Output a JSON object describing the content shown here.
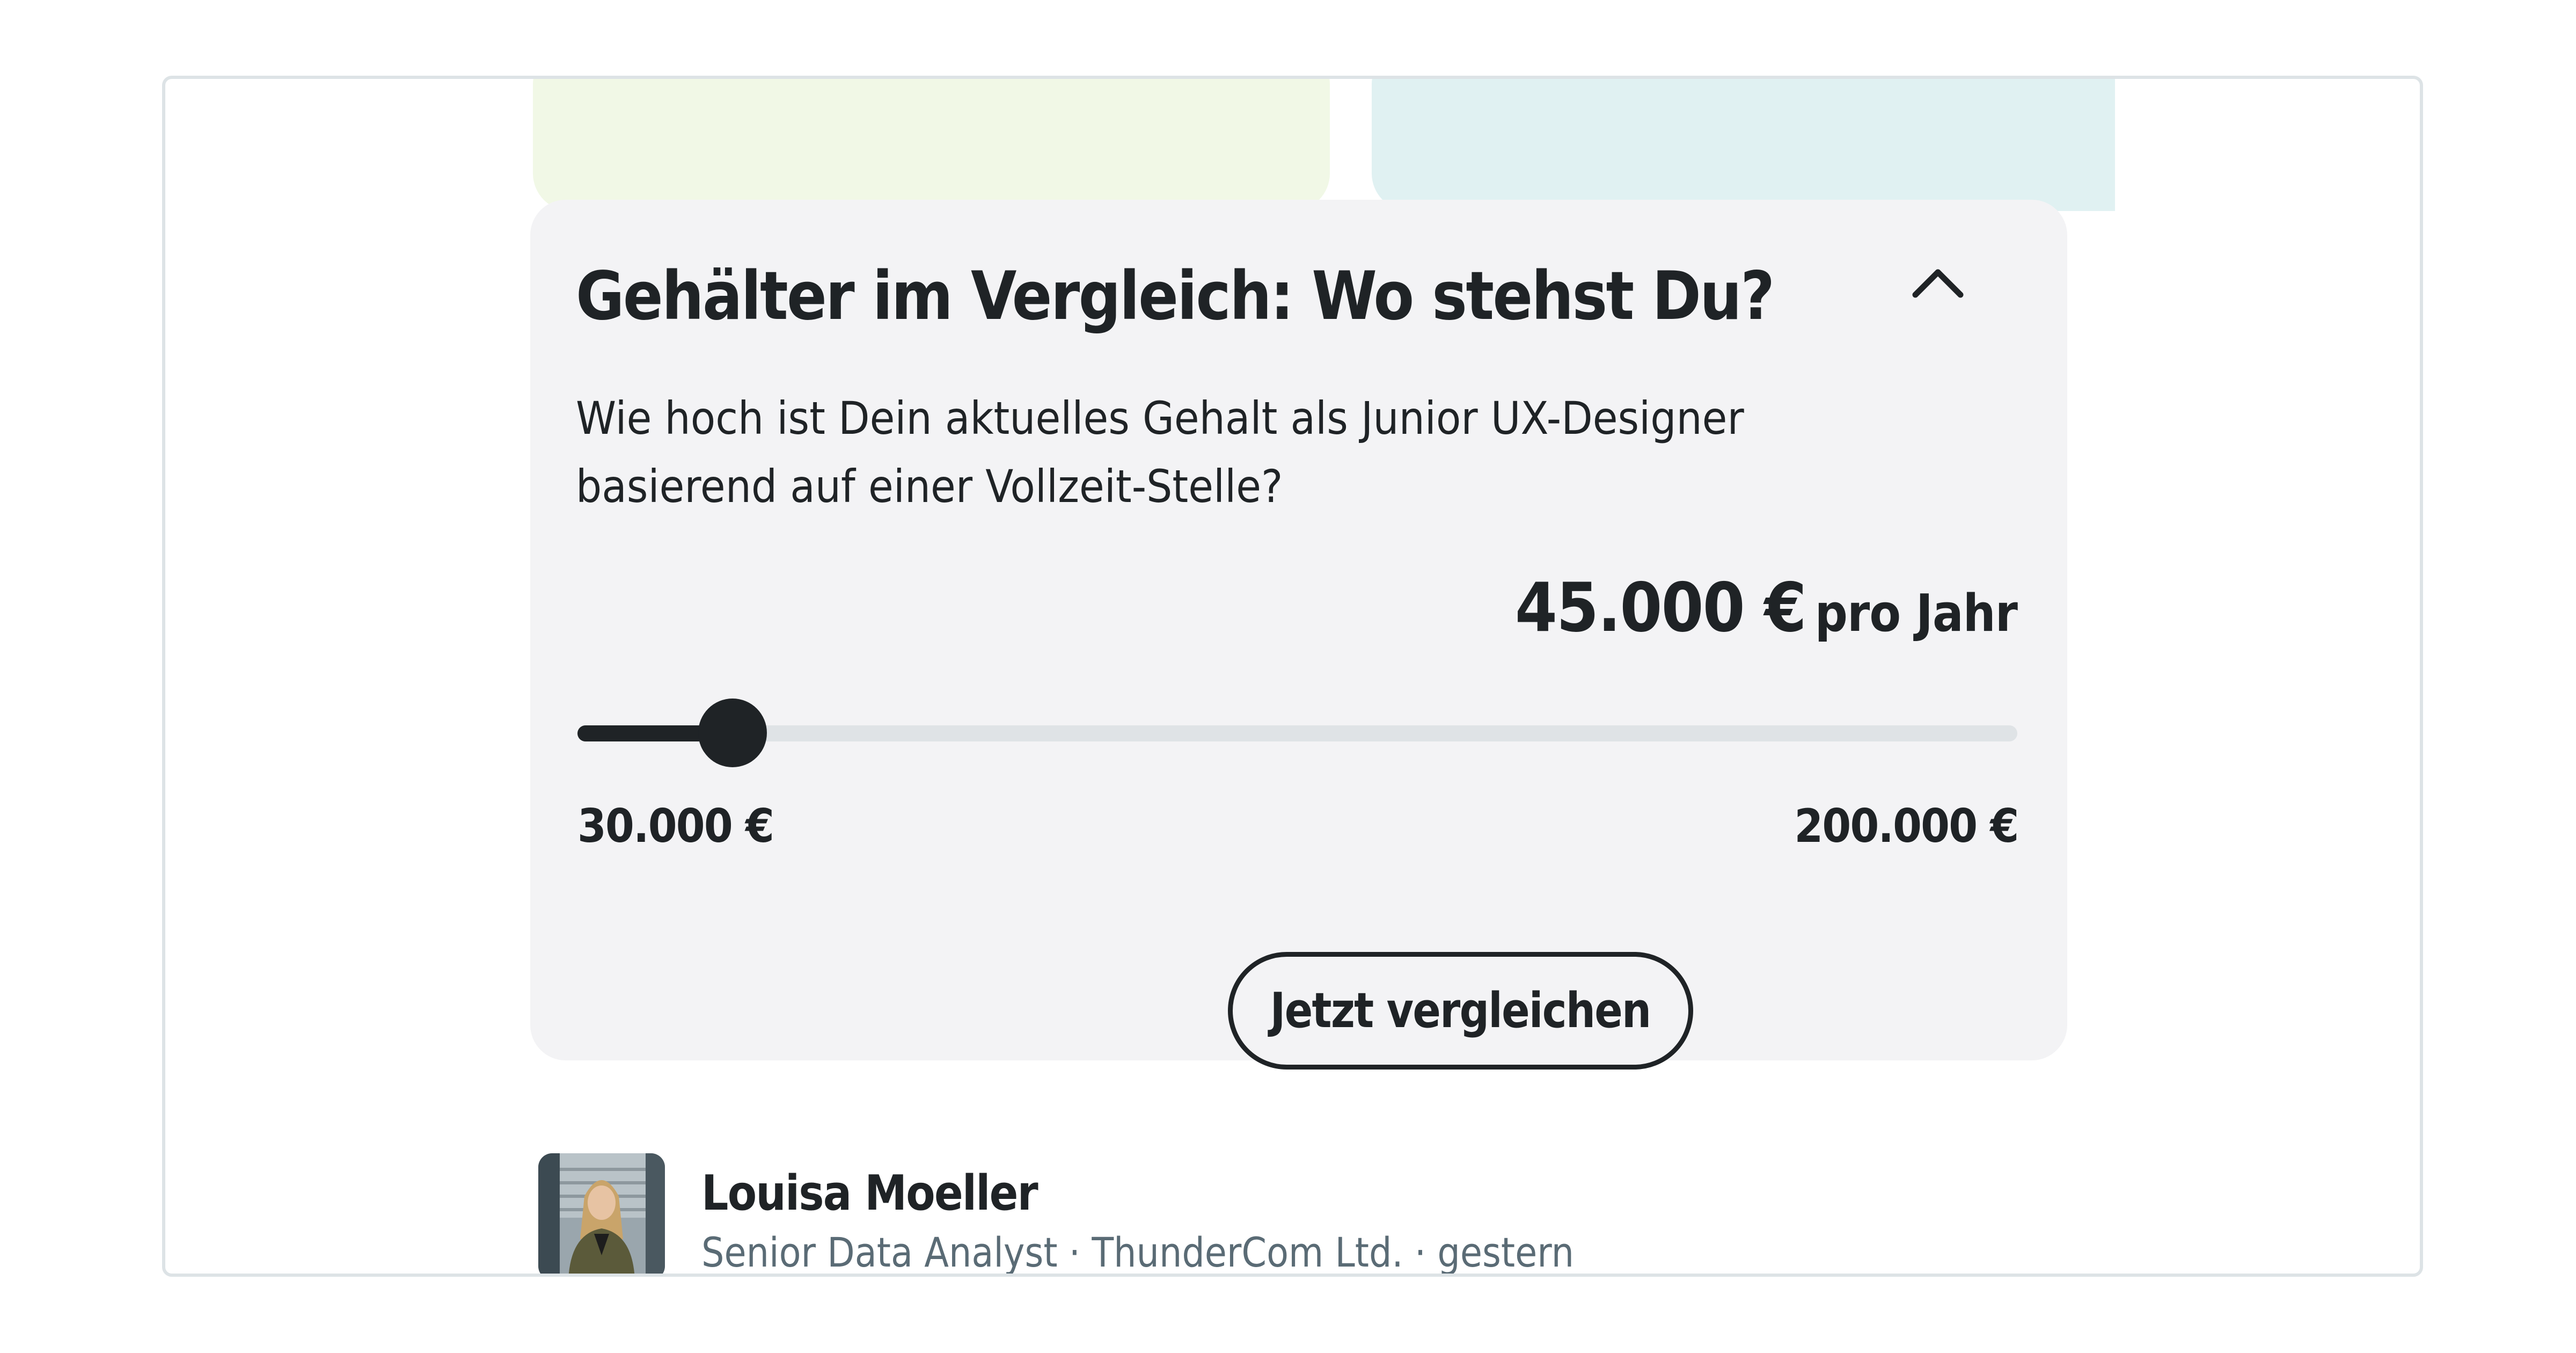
{
  "salary_widget": {
    "title": "Gehälter im Vergleich: Wo stehst Du?",
    "question": "Wie hoch ist Dein aktuelles Gehalt als Junior UX-Designer basierend auf einer Vollzeit-Stelle?",
    "amount": "45.000 €",
    "amount_unit": "pro Jahr",
    "slider": {
      "min": 30000,
      "max": 200000,
      "value": 45000,
      "min_label": "30.000 €",
      "max_label": "200.000 €"
    },
    "button_label": "Jetzt vergleichen",
    "toggle_icon": "chevron-up-icon"
  },
  "author": {
    "name": "Louisa Moeller",
    "meta": "Senior Data Analyst · ThunderCom Ltd. · gestern"
  },
  "colors": {
    "card_background": "#f3f3f5",
    "text": "#1f2326",
    "slider_track": "#dfe3e6",
    "meta_text": "#5a6b75",
    "top_card_green": "#f1f8e6",
    "top_card_teal": "#e0f1f2"
  }
}
